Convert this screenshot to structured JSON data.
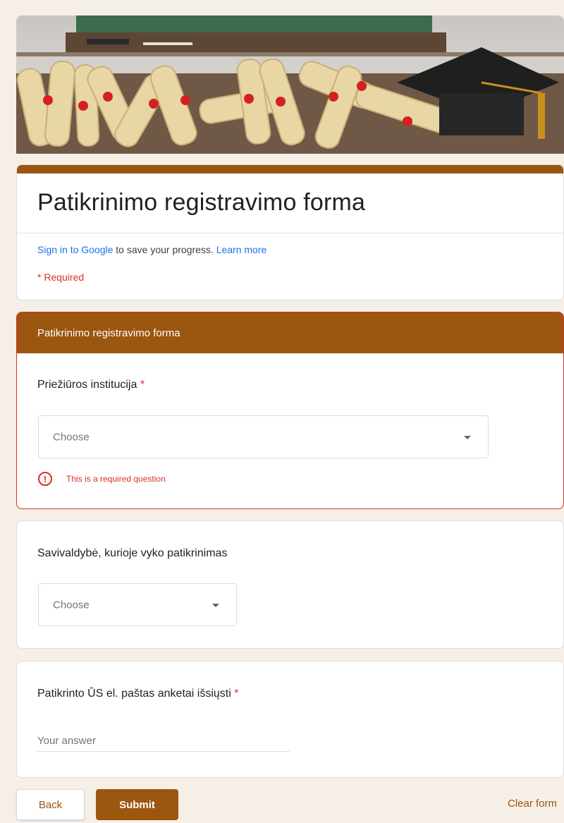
{
  "header": {
    "form_title": "Patikrinimo registravimo forma",
    "signin_link": "Sign in to Google",
    "signin_text": " to save your progress. ",
    "learn_more": "Learn more",
    "required_note": "* Required"
  },
  "section": {
    "title": "Patikrinimo registravimo forma"
  },
  "questions": [
    {
      "label": "Priežiūros institucija",
      "required_mark": "*",
      "dropdown_value": "Choose",
      "error": "This is a required question",
      "error_icon_glyph": "!"
    },
    {
      "label": "Savivaldybė, kurioje vyko patikrinimas",
      "dropdown_value": "Choose"
    },
    {
      "label": "Patikrinto ŪS el. paštas anketai išsiųsti",
      "required_mark": "*",
      "placeholder": "Your answer"
    }
  ],
  "actions": {
    "back_label": "Back",
    "submit_label": "Submit",
    "clear_label": "Clear form"
  },
  "colors": {
    "accent": "#9b560f",
    "error": "#d93025",
    "link": "#1a73e8",
    "page_background": "#f6efe8"
  },
  "icons": [
    "graduation-banner-image",
    "error-icon",
    "dropdown-caret-icon"
  ]
}
